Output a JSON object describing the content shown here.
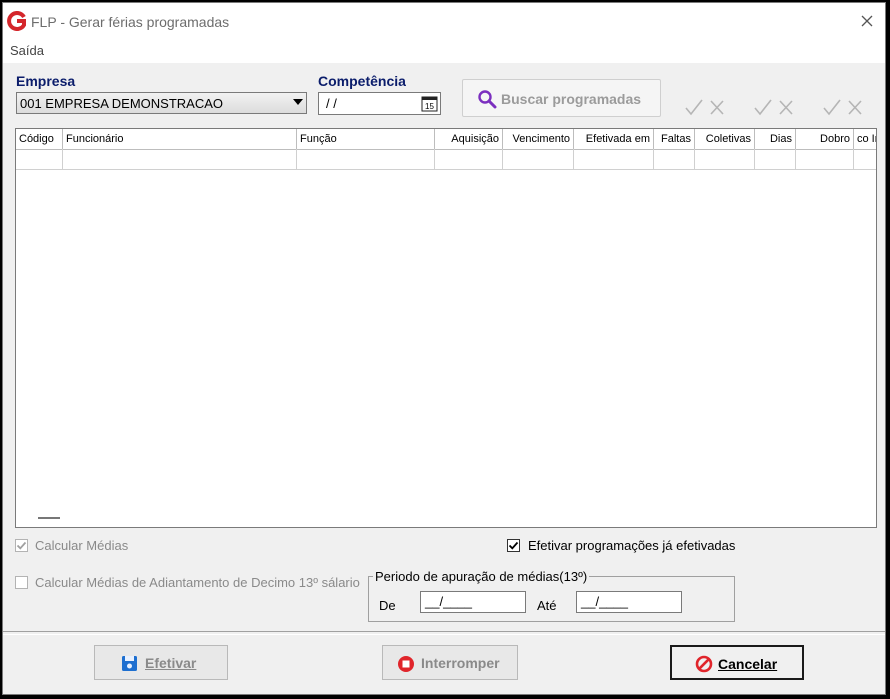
{
  "window": {
    "title": "FLP - Gerar férias programadas",
    "close_glyph": "✕"
  },
  "menu": {
    "items": [
      "Saída"
    ]
  },
  "empresa": {
    "label": "Empresa",
    "value": "001 EMPRESA DEMONSTRACAO"
  },
  "competencia": {
    "label": "Competência",
    "value": "/ /",
    "calendar_day": "15"
  },
  "buscar": {
    "label": "Buscar programadas"
  },
  "grid": {
    "columns": [
      "Código",
      "Funcionário",
      "Função",
      "Aquisição",
      "Vencimento",
      "Efetivada em",
      "Faltas",
      "Coletivas",
      "Dias",
      "Dobro",
      "co In"
    ]
  },
  "options": {
    "calcular_medias": "Calcular Médias",
    "calcular_medias_adiantamento": "Calcular Médias de Adiantamento de Decimo 13º sálario",
    "efetivar_ja_efetivadas": "Efetivar programações já efetivadas"
  },
  "periodo": {
    "title": "Periodo de apuração de médias(13º)",
    "de_label": "De",
    "de_value": "__/____",
    "ate_label": "Até",
    "ate_value": "__/____"
  },
  "buttons": {
    "efetivar": "Efetivar",
    "interromper": "Interromper",
    "cancelar": "Cancelar"
  },
  "colors": {
    "accent_label": "#0b1d6b",
    "search_icon": "#7b2fbf",
    "brand_red": "#d4262b",
    "stop_red": "#e0252b",
    "save_blue": "#1e6fd0"
  }
}
